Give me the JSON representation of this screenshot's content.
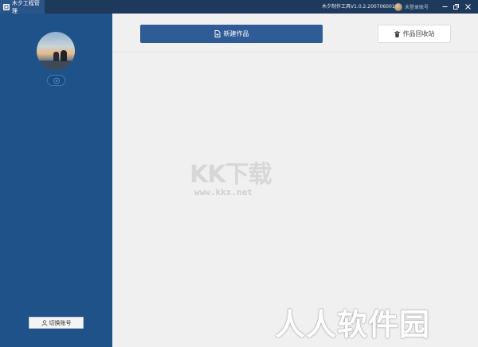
{
  "titlebar": {
    "app_title": "木夕工程管理",
    "version": "木夕制作工具V1.0.2.200706001",
    "user_name": "未登录账号",
    "minimize_glyph": "—",
    "maximize_glyph": "❐",
    "close_glyph": "✕"
  },
  "sidebar": {
    "switch_account_label": "切换账号"
  },
  "toolbar": {
    "new_work_label": "新建作品",
    "recycle_bin_label": "作品回收站"
  },
  "watermarks": {
    "kk_logo": "KK下载",
    "kk_url": "www.kkx.net",
    "rr_logo": "人人软件园"
  },
  "colors": {
    "sidebar": "#1e5289",
    "titlebar": "#1d3a5c",
    "primary_button": "#2f5c96",
    "content_bg": "#f0f0f0"
  },
  "icons": {
    "app": "app-icon",
    "new_work": "document-plus-icon",
    "recycle_bin": "trash-icon",
    "switch_account": "user-icon",
    "badge": "vip-badge-icon"
  }
}
